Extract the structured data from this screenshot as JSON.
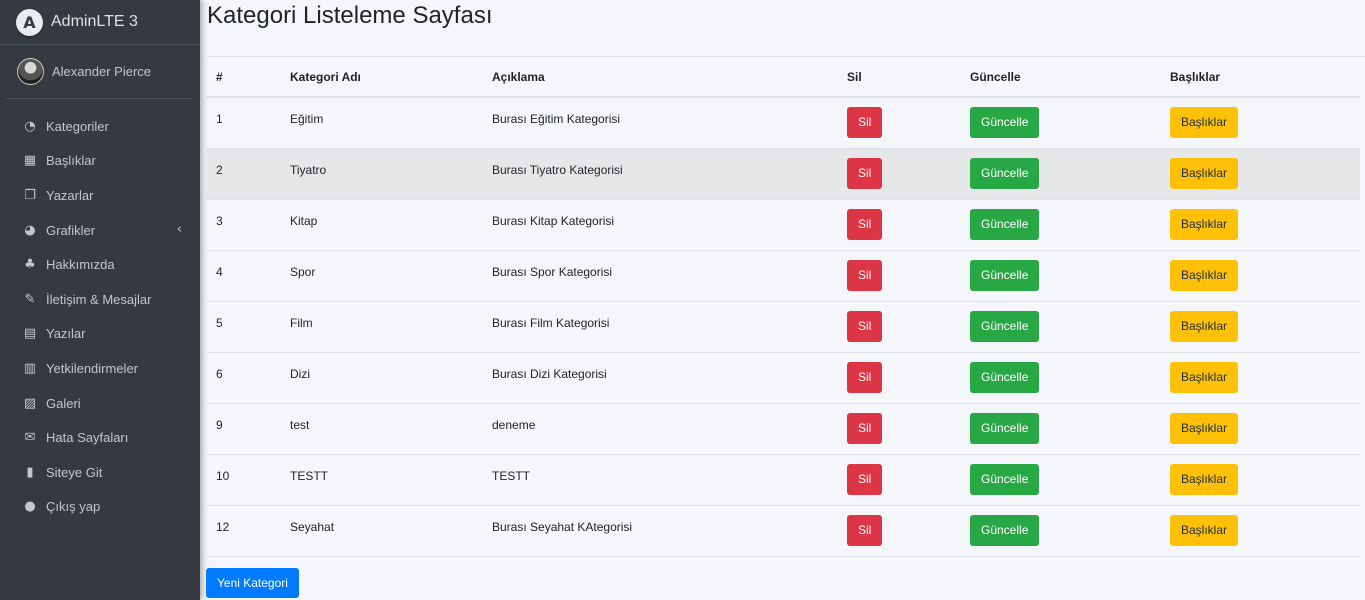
{
  "brand": {
    "name": "AdminLTE 3",
    "logo_letter": "A"
  },
  "user": {
    "name": "Alexander Pierce"
  },
  "nav": [
    {
      "label": "Kategoriler",
      "icon": "tachometer-icon",
      "glyph": "◔"
    },
    {
      "label": "Başlıklar",
      "icon": "grid-icon",
      "glyph": "▦"
    },
    {
      "label": "Yazarlar",
      "icon": "copy-icon",
      "glyph": "❐"
    },
    {
      "label": "Grafikler",
      "icon": "pie-chart-icon",
      "glyph": "◕"
    },
    {
      "label": "Hakkımızda",
      "icon": "tree-icon",
      "glyph": "♣"
    },
    {
      "label": "İletişim & Mesajlar",
      "icon": "edit-icon",
      "glyph": "✎"
    },
    {
      "label": "Yazılar",
      "icon": "table-icon",
      "glyph": "▤"
    },
    {
      "label": "Yetkilendirmeler",
      "icon": "calendar-icon",
      "glyph": "▥"
    },
    {
      "label": "Galeri",
      "icon": "image-icon",
      "glyph": "▨"
    },
    {
      "label": "Hata Sayfaları",
      "icon": "envelope-icon",
      "glyph": "✉"
    },
    {
      "label": "Siteye Git",
      "icon": "book-icon",
      "glyph": "▮"
    },
    {
      "label": "Çıkış yap",
      "icon": "apple-icon",
      "glyph": "●"
    }
  ],
  "nav_arrow": "‹",
  "page": {
    "title": "Kategori Listeleme Sayfası"
  },
  "table": {
    "headers": [
      "#",
      "Kategori Adı",
      "Açıklama",
      "Sil",
      "Güncelle",
      "Başlıklar"
    ],
    "rows": [
      {
        "id": "1",
        "name": "Eğitim",
        "desc": "Burası Eğitim Kategorisi"
      },
      {
        "id": "2",
        "name": "Tiyatro",
        "desc": "Burası Tiyatro Kategorisi"
      },
      {
        "id": "3",
        "name": "Kitap",
        "desc": "Burası Kitap Kategorisi"
      },
      {
        "id": "4",
        "name": "Spor",
        "desc": "Burası Spor Kategorisi"
      },
      {
        "id": "5",
        "name": "Film",
        "desc": "Burası Film Kategorisi"
      },
      {
        "id": "6",
        "name": "Dizi",
        "desc": "Burası Dizi Kategorisi"
      },
      {
        "id": "9",
        "name": "test",
        "desc": "deneme"
      },
      {
        "id": "10",
        "name": "TESTT",
        "desc": "TESTT"
      },
      {
        "id": "12",
        "name": "Seyahat",
        "desc": "Burası Seyahat KAtegorisi"
      }
    ],
    "buttons": {
      "delete": "Sil",
      "update": "Güncelle",
      "titles": "Başlıklar"
    }
  },
  "new_button": "Yeni Kategori",
  "colors": {
    "danger": "#dc3545",
    "success": "#28a745",
    "warning": "#ffc107",
    "primary": "#007bff",
    "sidebar": "#343a40"
  }
}
